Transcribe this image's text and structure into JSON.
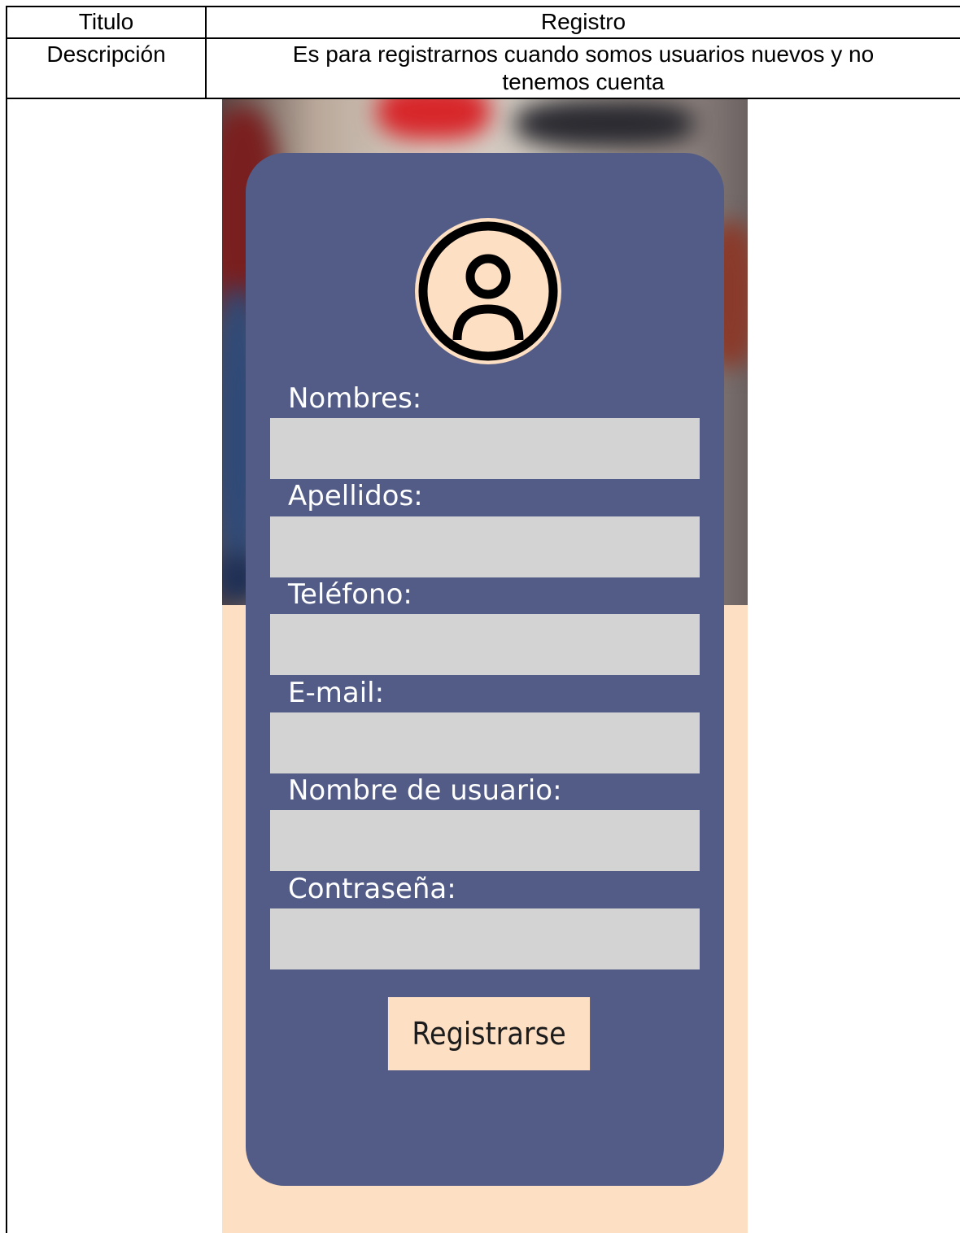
{
  "table": {
    "row1_label": "Titulo",
    "row1_value": "Registro",
    "row2_label": "Descripción",
    "row2_value_line1": "Es para registrarnos cuando somos usuarios nuevos y no",
    "row2_value_line2": "tenemos cuenta"
  },
  "form": {
    "avatar_icon": "user-circle-icon",
    "fields": [
      {
        "label": "Nombres:",
        "value": "",
        "placeholder": ""
      },
      {
        "label": "Apellidos:",
        "value": "",
        "placeholder": ""
      },
      {
        "label": "Teléfono:",
        "value": "",
        "placeholder": ""
      },
      {
        "label": "E-mail:",
        "value": "",
        "placeholder": ""
      },
      {
        "label": "Nombre de usuario:",
        "value": "",
        "placeholder": ""
      },
      {
        "label": "Contraseña:",
        "value": "",
        "placeholder": ""
      }
    ],
    "submit_label": "Registrarse"
  },
  "colors": {
    "card": "#525c86",
    "peach": "#fddfc4",
    "input": "#d3d3d3"
  }
}
